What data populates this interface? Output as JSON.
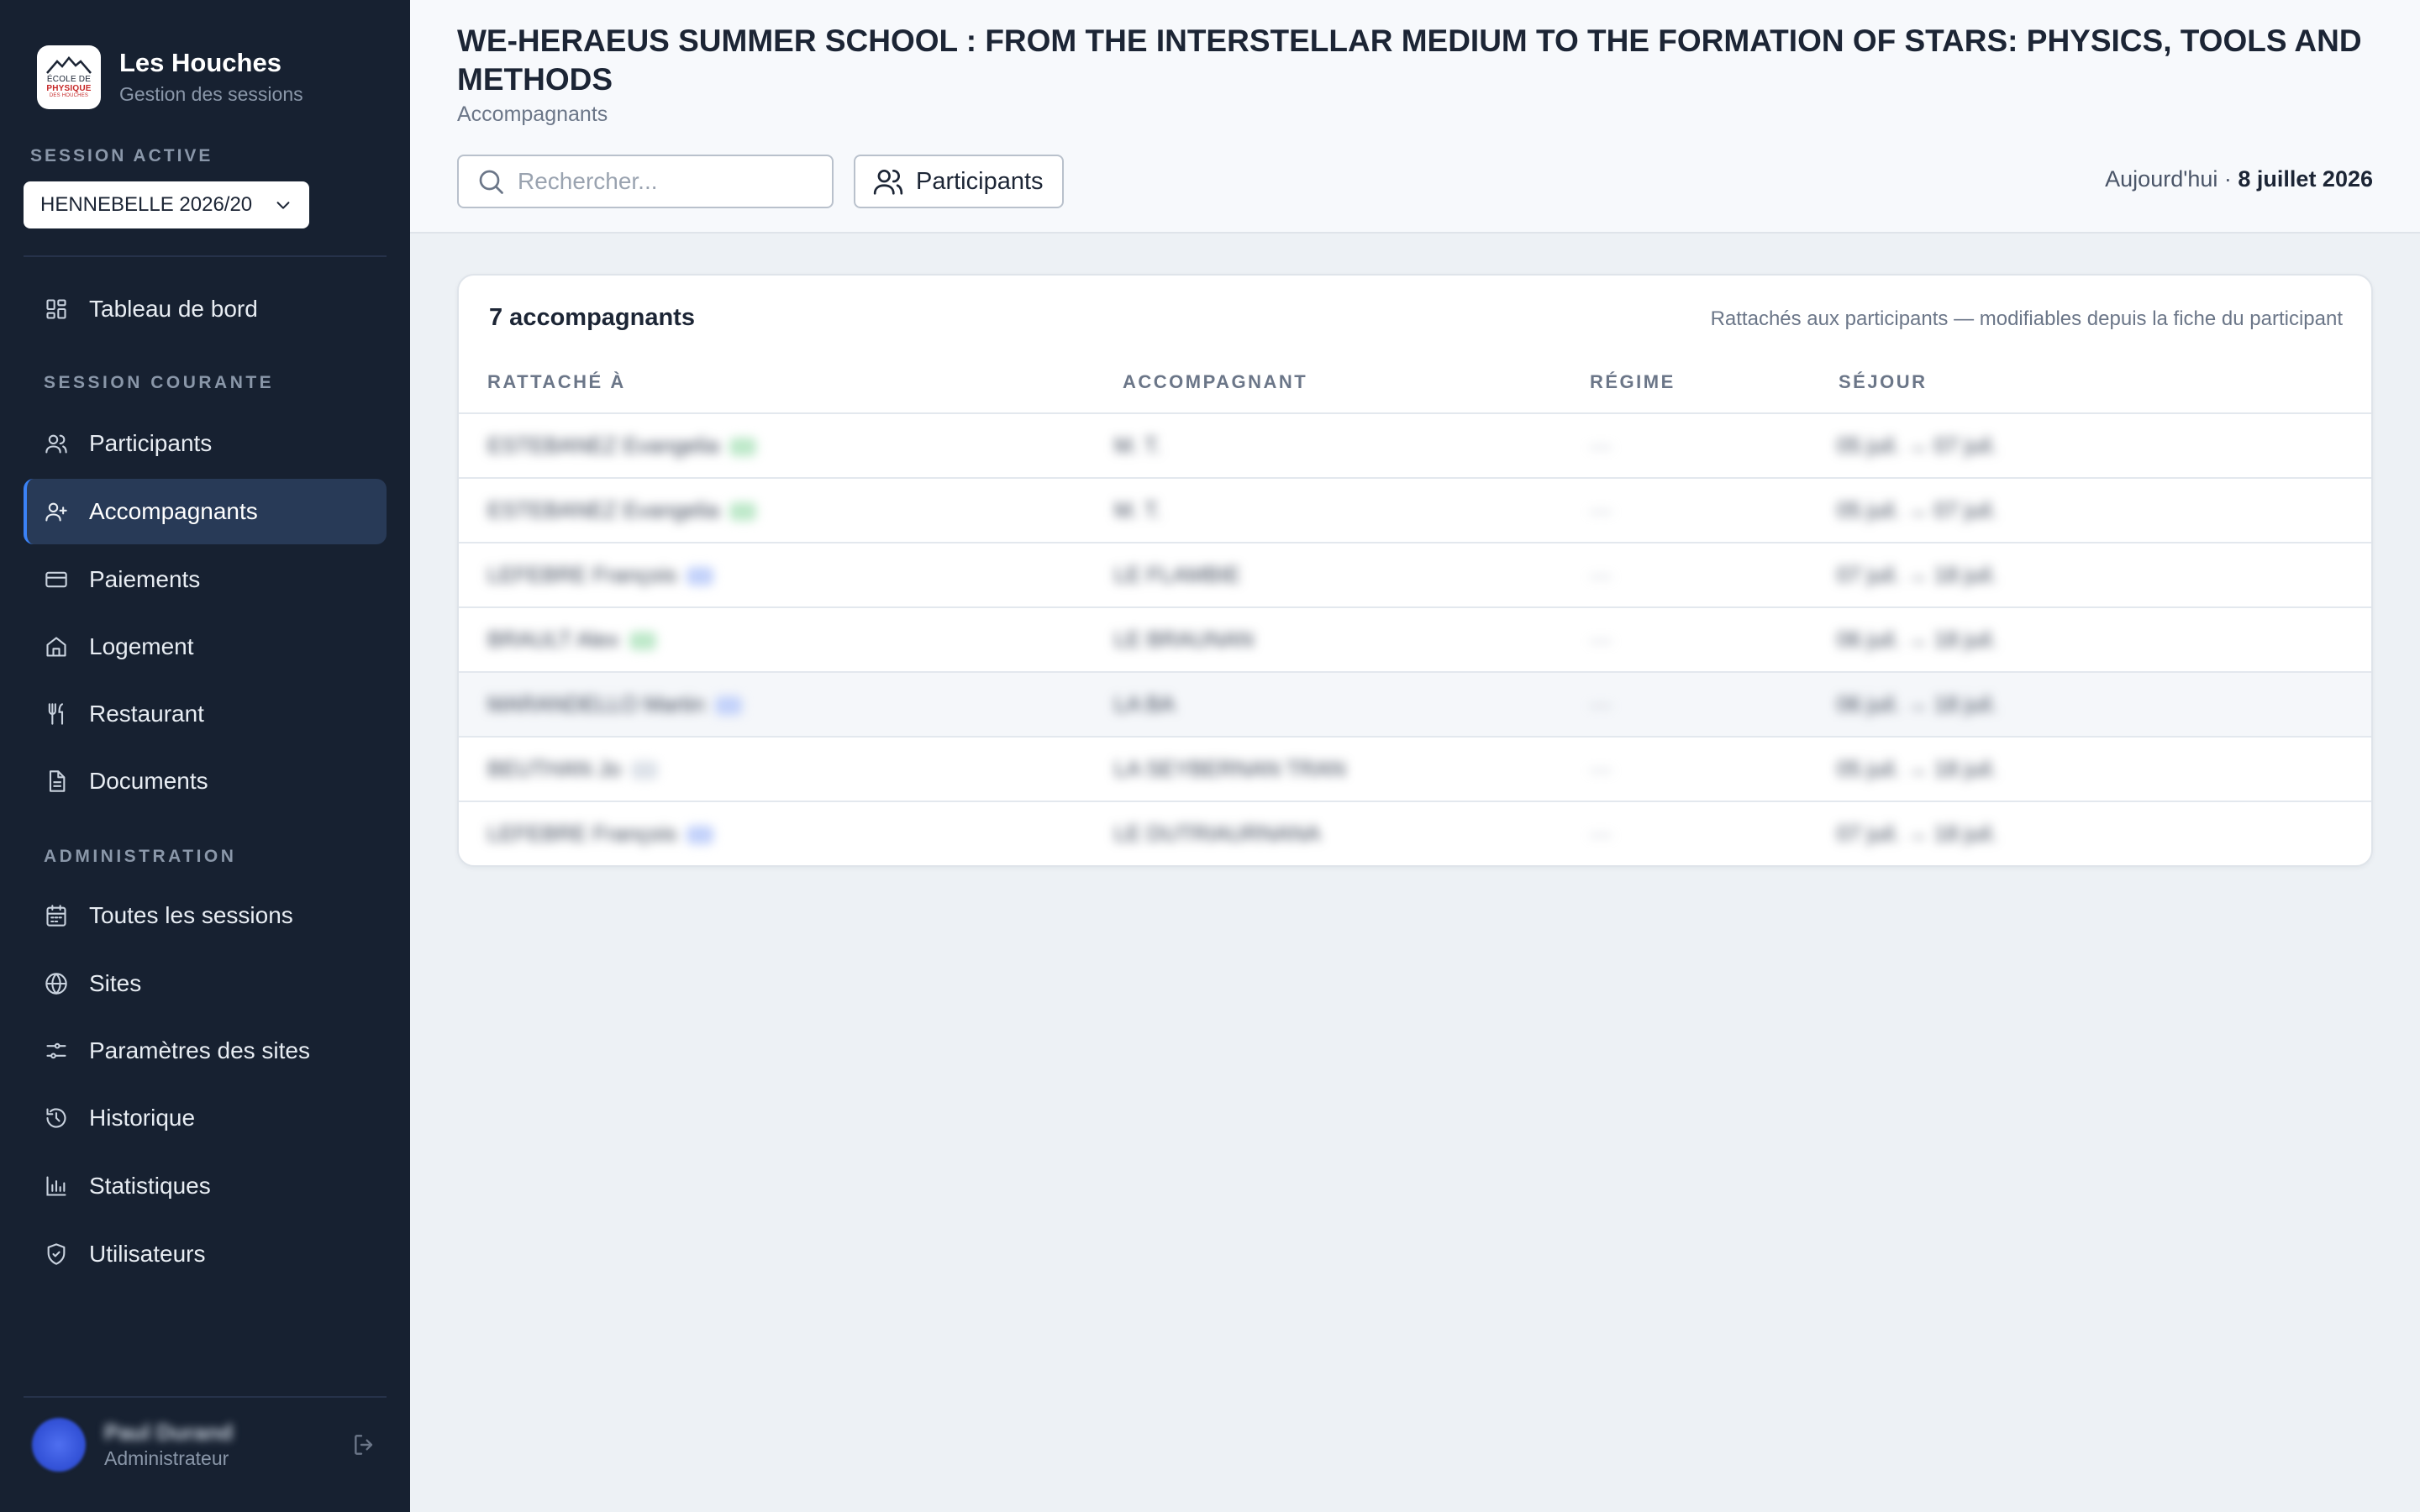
{
  "app": {
    "name": "Les Houches",
    "subtitle": "Gestion des sessions",
    "logo": {
      "line1": "ÉCOLE DE",
      "line2": "PHYSIQUE",
      "line3": "DES HOUCHES"
    }
  },
  "session": {
    "label": "SESSION ACTIVE",
    "selected": "HENNEBELLE 2026/20"
  },
  "nav": {
    "dashboard": "Tableau de bord",
    "current_section": "SESSION COURANTE",
    "current_items": [
      {
        "label": "Participants",
        "icon": "users-icon"
      },
      {
        "label": "Accompagnants",
        "icon": "user-plus-icon",
        "active": true
      },
      {
        "label": "Paiements",
        "icon": "credit-card-icon"
      },
      {
        "label": "Logement",
        "icon": "home-icon"
      },
      {
        "label": "Restaurant",
        "icon": "utensils-icon"
      },
      {
        "label": "Documents",
        "icon": "document-icon"
      }
    ],
    "admin_section": "ADMINISTRATION",
    "admin_items": [
      {
        "label": "Toutes les sessions",
        "icon": "calendar-icon"
      },
      {
        "label": "Sites",
        "icon": "globe-icon"
      },
      {
        "label": "Paramètres des sites",
        "icon": "sliders-icon"
      },
      {
        "label": "Historique",
        "icon": "history-icon"
      },
      {
        "label": "Statistiques",
        "icon": "bar-chart-icon"
      },
      {
        "label": "Utilisateurs",
        "icon": "shield-icon"
      }
    ]
  },
  "user": {
    "name": "Paul Durand",
    "role": "Administrateur"
  },
  "header": {
    "title": "WE-HERAEUS SUMMER SCHOOL : FROM THE INTERSTELLAR MEDIUM TO THE FORMATION OF STARS: PHYSICS, TOOLS AND METHODS",
    "subtitle": "Accompagnants",
    "search_placeholder": "Rechercher...",
    "participants_button": "Participants",
    "today_label": "Aujourd'hui · ",
    "today_date": "8 juillet 2026"
  },
  "table": {
    "count": "7 accompagnants",
    "note": "Rattachés aux participants — modifiables depuis la fiche du participant",
    "columns": [
      "RATTACHÉ À",
      "ACCOMPAGNANT",
      "RÉGIME",
      "SÉJOUR"
    ],
    "rows": [
      {
        "attached": "ESTEBANEZ Evangelia",
        "companion": "M. T.",
        "regime": "—",
        "stay": "05 juil. → 07 juil."
      },
      {
        "attached": "ESTEBANEZ Evangelia",
        "companion": "M. T.",
        "regime": "—",
        "stay": "05 juil. → 07 juil."
      },
      {
        "attached": "LEFEBRE François",
        "companion": "LE FLAMBIE",
        "regime": "—",
        "stay": "07 juil. → 18 juil."
      },
      {
        "attached": "BRAULT Alex",
        "companion": "LE BRAUNAN",
        "regime": "—",
        "stay": "06 juil. → 18 juil."
      },
      {
        "attached": "MARANDELLO Martin",
        "companion": "LA BA",
        "regime": "—",
        "stay": "06 juil. → 18 juil."
      },
      {
        "attached": "BEUTHAN Jo",
        "companion": "LA SEYBERNAN TRAN",
        "regime": "—",
        "stay": "05 juil. → 18 juil."
      },
      {
        "attached": "LEFEBRE François",
        "companion": "LE DUTRIAURNANA",
        "regime": "—",
        "stay": "07 juil. → 18 juil."
      }
    ]
  }
}
